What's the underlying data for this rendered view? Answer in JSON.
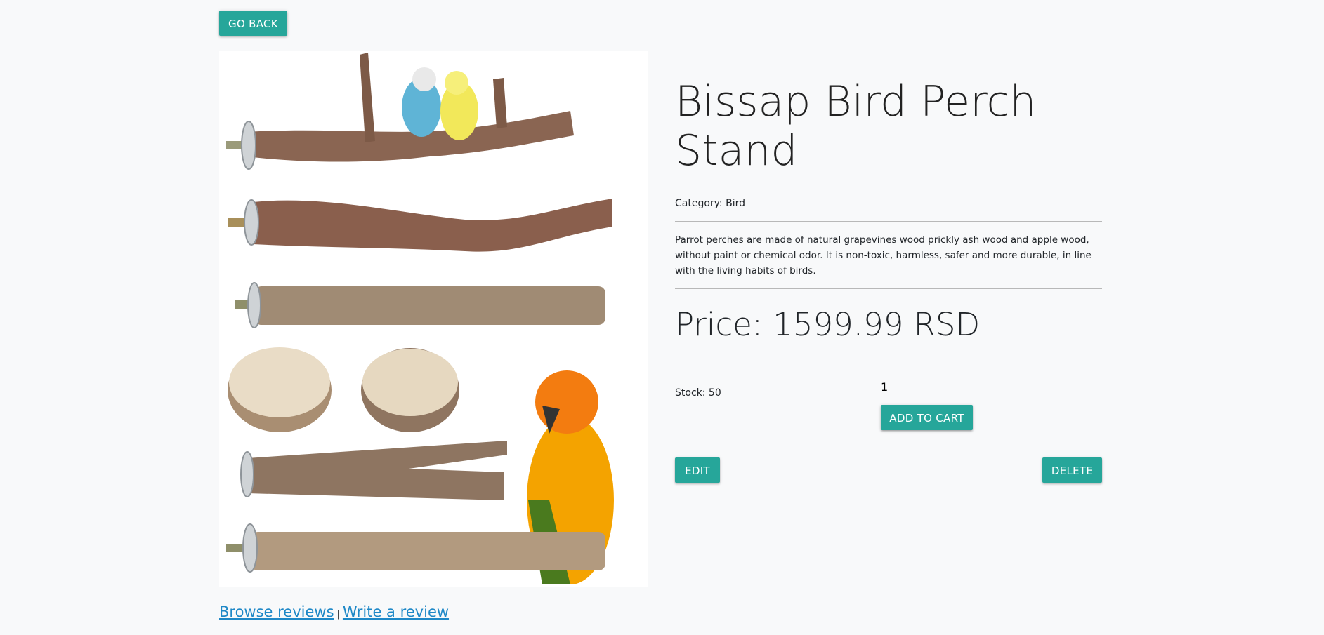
{
  "nav": {
    "go_back_label": "GO BACK"
  },
  "product": {
    "title": "Bissap Bird Perch Stand",
    "category": "Category: Bird",
    "description": "Parrot perches are made of natural grapevines wood prickly ash wood and apple wood, without paint or chemical odor. It is non-toxic, harmless, safer and more durable, in line with the living habits of birds.",
    "price": "Price: 1599.99 RSD",
    "stock": "Stock: 50",
    "quantity": "1"
  },
  "actions": {
    "add_to_cart_label": "ADD TO CART",
    "edit_label": "EDIT",
    "delete_label": "DELETE"
  },
  "reviews": {
    "browse_label": "Browse reviews",
    "separator": "|",
    "write_label": "Write a review"
  },
  "colors": {
    "accent": "#26a69a",
    "link": "#1e88c7",
    "background": "#f8f9fa"
  }
}
